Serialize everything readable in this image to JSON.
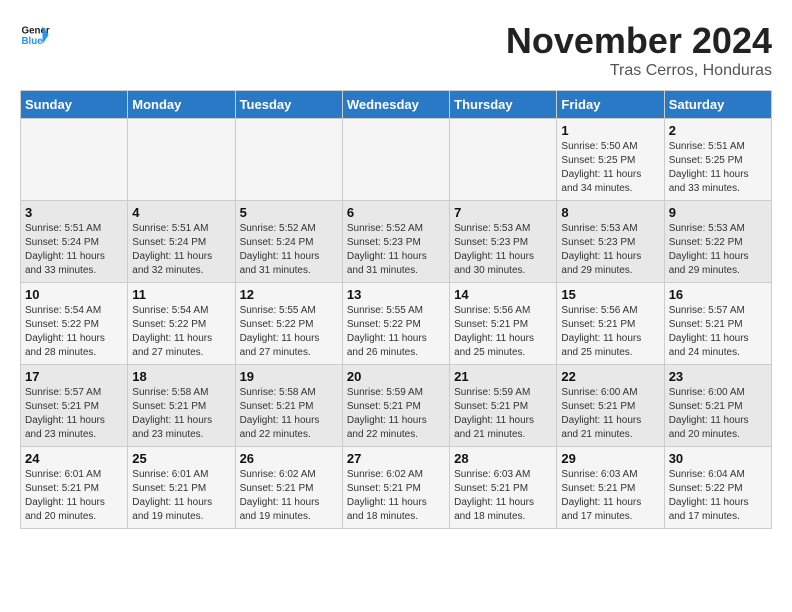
{
  "header": {
    "logo_line1": "General",
    "logo_line2": "Blue",
    "month": "November 2024",
    "location": "Tras Cerros, Honduras"
  },
  "weekdays": [
    "Sunday",
    "Monday",
    "Tuesday",
    "Wednesday",
    "Thursday",
    "Friday",
    "Saturday"
  ],
  "weeks": [
    [
      {
        "day": "",
        "info": ""
      },
      {
        "day": "",
        "info": ""
      },
      {
        "day": "",
        "info": ""
      },
      {
        "day": "",
        "info": ""
      },
      {
        "day": "",
        "info": ""
      },
      {
        "day": "1",
        "info": "Sunrise: 5:50 AM\nSunset: 5:25 PM\nDaylight: 11 hours\nand 34 minutes."
      },
      {
        "day": "2",
        "info": "Sunrise: 5:51 AM\nSunset: 5:25 PM\nDaylight: 11 hours\nand 33 minutes."
      }
    ],
    [
      {
        "day": "3",
        "info": "Sunrise: 5:51 AM\nSunset: 5:24 PM\nDaylight: 11 hours\nand 33 minutes."
      },
      {
        "day": "4",
        "info": "Sunrise: 5:51 AM\nSunset: 5:24 PM\nDaylight: 11 hours\nand 32 minutes."
      },
      {
        "day": "5",
        "info": "Sunrise: 5:52 AM\nSunset: 5:24 PM\nDaylight: 11 hours\nand 31 minutes."
      },
      {
        "day": "6",
        "info": "Sunrise: 5:52 AM\nSunset: 5:23 PM\nDaylight: 11 hours\nand 31 minutes."
      },
      {
        "day": "7",
        "info": "Sunrise: 5:53 AM\nSunset: 5:23 PM\nDaylight: 11 hours\nand 30 minutes."
      },
      {
        "day": "8",
        "info": "Sunrise: 5:53 AM\nSunset: 5:23 PM\nDaylight: 11 hours\nand 29 minutes."
      },
      {
        "day": "9",
        "info": "Sunrise: 5:53 AM\nSunset: 5:22 PM\nDaylight: 11 hours\nand 29 minutes."
      }
    ],
    [
      {
        "day": "10",
        "info": "Sunrise: 5:54 AM\nSunset: 5:22 PM\nDaylight: 11 hours\nand 28 minutes."
      },
      {
        "day": "11",
        "info": "Sunrise: 5:54 AM\nSunset: 5:22 PM\nDaylight: 11 hours\nand 27 minutes."
      },
      {
        "day": "12",
        "info": "Sunrise: 5:55 AM\nSunset: 5:22 PM\nDaylight: 11 hours\nand 27 minutes."
      },
      {
        "day": "13",
        "info": "Sunrise: 5:55 AM\nSunset: 5:22 PM\nDaylight: 11 hours\nand 26 minutes."
      },
      {
        "day": "14",
        "info": "Sunrise: 5:56 AM\nSunset: 5:21 PM\nDaylight: 11 hours\nand 25 minutes."
      },
      {
        "day": "15",
        "info": "Sunrise: 5:56 AM\nSunset: 5:21 PM\nDaylight: 11 hours\nand 25 minutes."
      },
      {
        "day": "16",
        "info": "Sunrise: 5:57 AM\nSunset: 5:21 PM\nDaylight: 11 hours\nand 24 minutes."
      }
    ],
    [
      {
        "day": "17",
        "info": "Sunrise: 5:57 AM\nSunset: 5:21 PM\nDaylight: 11 hours\nand 23 minutes."
      },
      {
        "day": "18",
        "info": "Sunrise: 5:58 AM\nSunset: 5:21 PM\nDaylight: 11 hours\nand 23 minutes."
      },
      {
        "day": "19",
        "info": "Sunrise: 5:58 AM\nSunset: 5:21 PM\nDaylight: 11 hours\nand 22 minutes."
      },
      {
        "day": "20",
        "info": "Sunrise: 5:59 AM\nSunset: 5:21 PM\nDaylight: 11 hours\nand 22 minutes."
      },
      {
        "day": "21",
        "info": "Sunrise: 5:59 AM\nSunset: 5:21 PM\nDaylight: 11 hours\nand 21 minutes."
      },
      {
        "day": "22",
        "info": "Sunrise: 6:00 AM\nSunset: 5:21 PM\nDaylight: 11 hours\nand 21 minutes."
      },
      {
        "day": "23",
        "info": "Sunrise: 6:00 AM\nSunset: 5:21 PM\nDaylight: 11 hours\nand 20 minutes."
      }
    ],
    [
      {
        "day": "24",
        "info": "Sunrise: 6:01 AM\nSunset: 5:21 PM\nDaylight: 11 hours\nand 20 minutes."
      },
      {
        "day": "25",
        "info": "Sunrise: 6:01 AM\nSunset: 5:21 PM\nDaylight: 11 hours\nand 19 minutes."
      },
      {
        "day": "26",
        "info": "Sunrise: 6:02 AM\nSunset: 5:21 PM\nDaylight: 11 hours\nand 19 minutes."
      },
      {
        "day": "27",
        "info": "Sunrise: 6:02 AM\nSunset: 5:21 PM\nDaylight: 11 hours\nand 18 minutes."
      },
      {
        "day": "28",
        "info": "Sunrise: 6:03 AM\nSunset: 5:21 PM\nDaylight: 11 hours\nand 18 minutes."
      },
      {
        "day": "29",
        "info": "Sunrise: 6:03 AM\nSunset: 5:21 PM\nDaylight: 11 hours\nand 17 minutes."
      },
      {
        "day": "30",
        "info": "Sunrise: 6:04 AM\nSunset: 5:22 PM\nDaylight: 11 hours\nand 17 minutes."
      }
    ]
  ]
}
